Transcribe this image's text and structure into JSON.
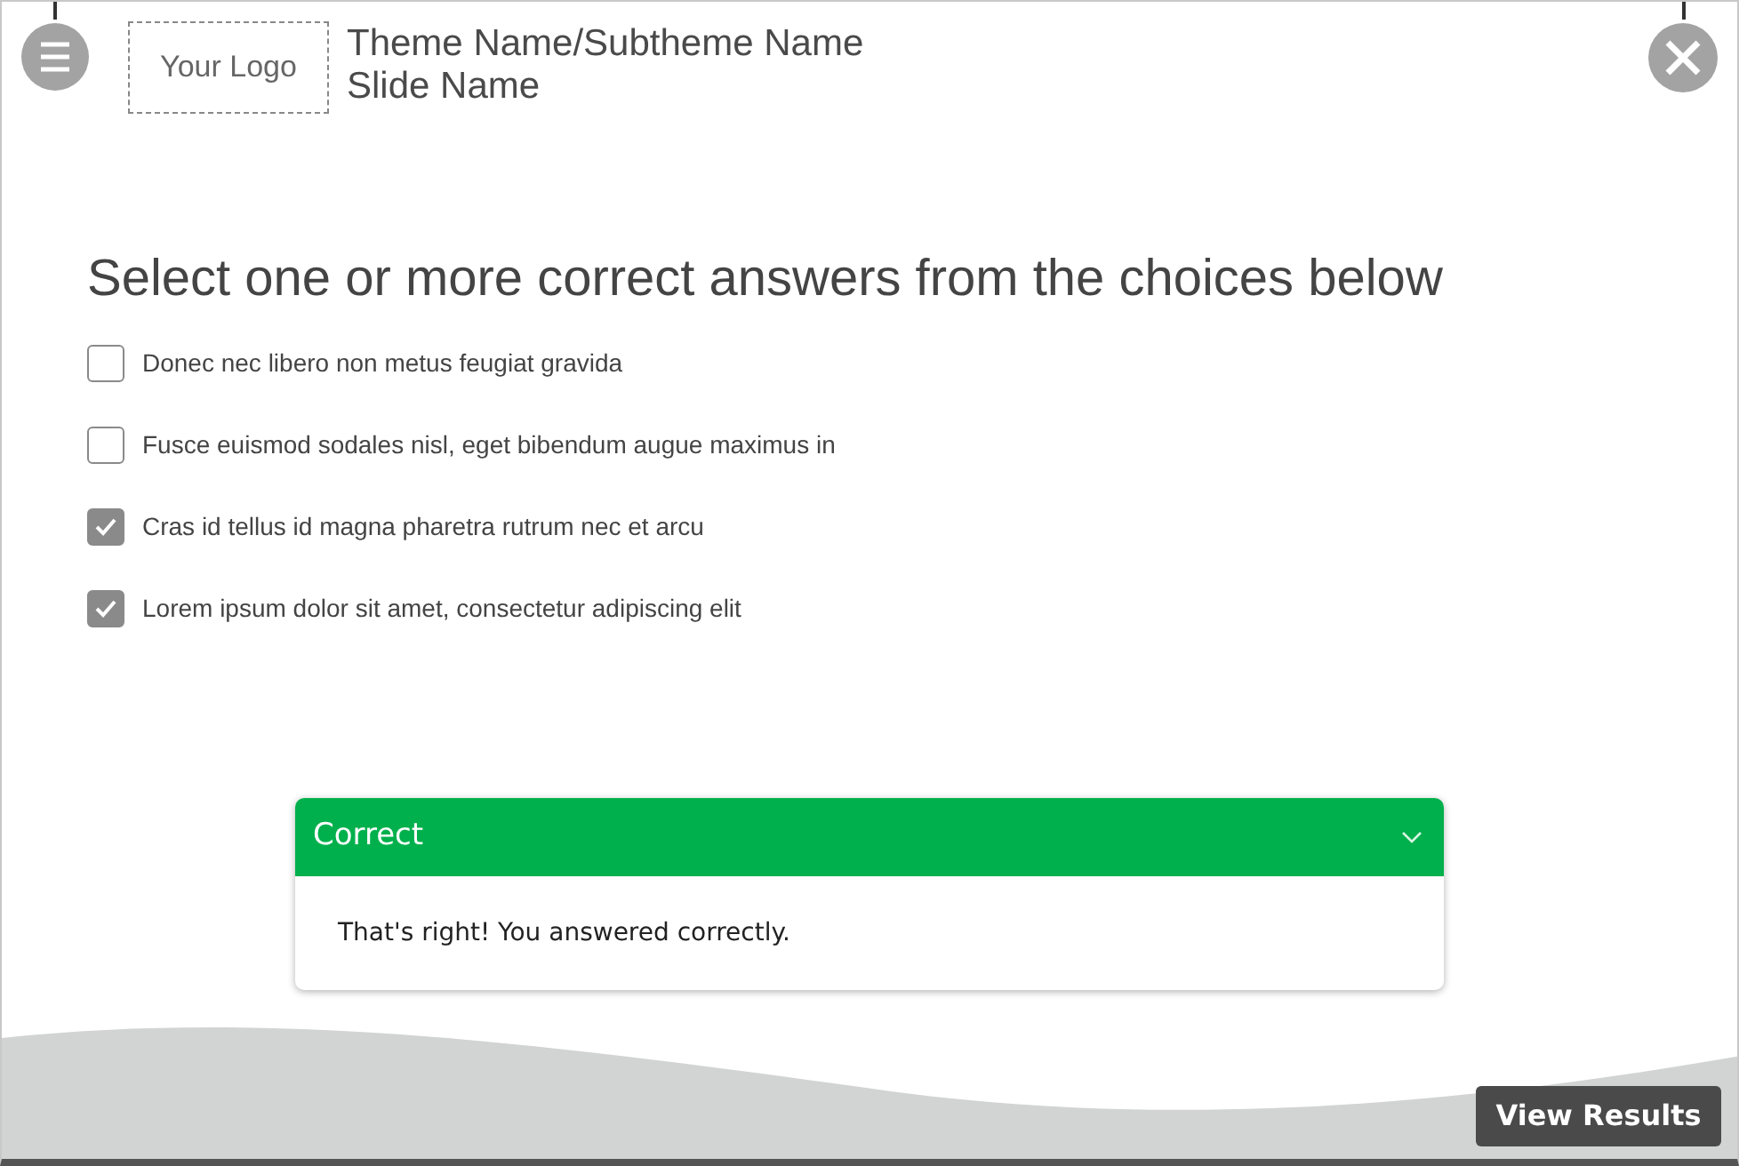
{
  "header": {
    "logo": "Your Logo",
    "theme": "Theme Name/Subtheme  Name",
    "slide": "Slide Name"
  },
  "question": "Select one or more correct answers from the choices below",
  "choices": [
    {
      "label": "Donec nec libero non metus feugiat gravida",
      "checked": false
    },
    {
      "label": "Fusce euismod sodales nisl, eget bibendum augue maximus in",
      "checked": false
    },
    {
      "label": "Cras id tellus id magna pharetra rutrum nec et arcu",
      "checked": true
    },
    {
      "label": "Lorem ipsum dolor sit amet, consectetur adipiscing elit",
      "checked": true
    }
  ],
  "feedback": {
    "title": "Correct",
    "message": "That's right! You answered correctly.",
    "expanded": true
  },
  "button": "View Results"
}
